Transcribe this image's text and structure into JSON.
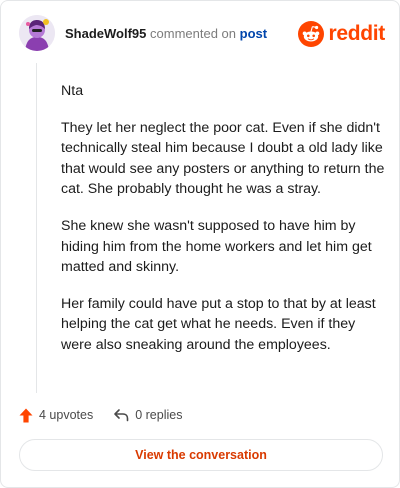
{
  "header": {
    "username": "ShadeWolf95",
    "action_text": "commented on",
    "post_link": "post",
    "brand": "reddit"
  },
  "comment": {
    "paragraphs": [
      "Nta",
      "They let her neglect the poor cat. Even if she didn't technically steal him because I doubt a old lady like that would see any posters or anything to return the cat. She probably thought he was a stray.",
      "She knew she wasn't supposed to have him by hiding him from the home workers and let him get matted and skinny.",
      "Her family could have put a stop to that by at least helping the cat get what he needs. Even if they were also sneaking around the employees."
    ]
  },
  "footer": {
    "upvotes": "4 upvotes",
    "replies": "0 replies",
    "cta": "View the conversation"
  },
  "colors": {
    "brand": "#ff4500",
    "link": "#0045ac",
    "cta": "#d93a00"
  },
  "icons": {
    "avatar": "avatar-image",
    "brand": "reddit-logo-icon",
    "upvote": "upvote-arrow-icon",
    "reply": "reply-arrow-icon"
  }
}
